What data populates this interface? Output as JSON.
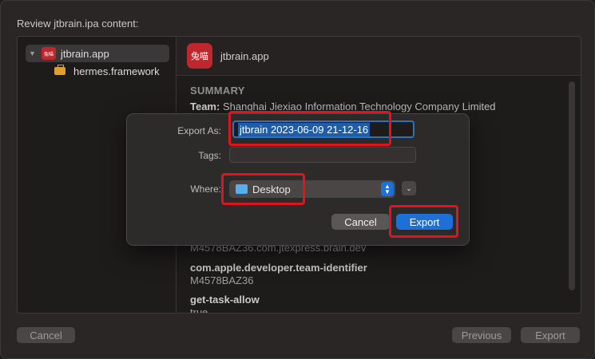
{
  "window": {
    "title": "Review jtbrain.ipa content:"
  },
  "sidebar": {
    "items": [
      {
        "label": "jtbrain.app",
        "icon": "app-icon",
        "icon_text": "兔喵",
        "expanded": true
      },
      {
        "label": "hermes.framework",
        "icon": "toolbox-icon"
      }
    ]
  },
  "detail": {
    "app_name": "jtbrain.app",
    "icon_text": "兔喵",
    "summary_title": "SUMMARY",
    "team_label": "Team:",
    "team_value": "Shanghai Jiexiao Information Technology Company Limited",
    "entitlements": [
      {
        "text": "M4578BAZ36.com.jtexpress.brain.dev",
        "kind": "value"
      },
      {
        "text": "com.apple.developer.team-identifier",
        "kind": "key"
      },
      {
        "text": "M4578BAZ36",
        "kind": "value"
      },
      {
        "text": "get-task-allow",
        "kind": "key"
      },
      {
        "text": "true",
        "kind": "value"
      }
    ]
  },
  "footer": {
    "cancel": "Cancel",
    "previous": "Previous",
    "export": "Export"
  },
  "dialog": {
    "export_as_label": "Export As:",
    "export_as_value": "jtbrain 2023-06-09 21-12-16",
    "tags_label": "Tags:",
    "tags_value": "",
    "where_label": "Where:",
    "where_value": "Desktop",
    "cancel": "Cancel",
    "export": "Export"
  },
  "colors": {
    "accent": "#1f6fd8",
    "highlight": "#e0141f",
    "app_icon": "#c0272d"
  }
}
